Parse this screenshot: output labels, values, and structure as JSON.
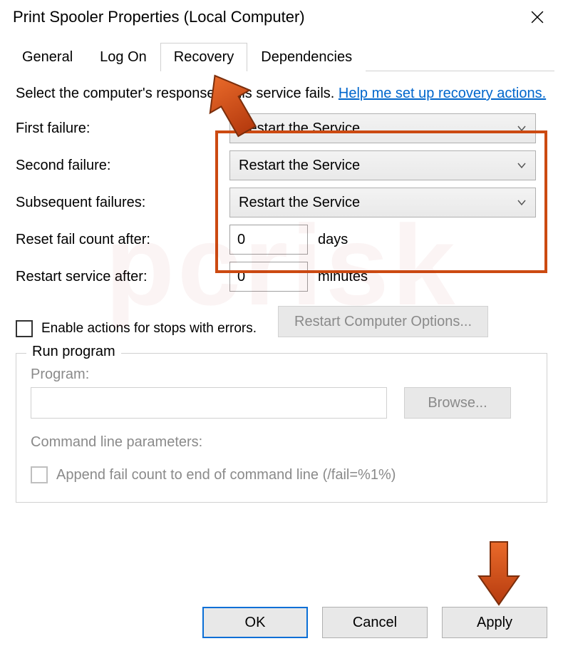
{
  "title": "Print Spooler Properties (Local Computer)",
  "tabs": {
    "general": "General",
    "logon": "Log On",
    "recovery": "Recovery",
    "dependencies": "Dependencies"
  },
  "intro": {
    "text_before": "Select the computer's response if this service fails. ",
    "link": "Help me set up recovery actions."
  },
  "failure": {
    "first_label": "First failure:",
    "first_value": "Restart the Service",
    "second_label": "Second failure:",
    "second_value": "Restart the Service",
    "subsequent_label": "Subsequent failures:",
    "subsequent_value": "Restart the Service"
  },
  "reset": {
    "label": "Reset fail count after:",
    "value": "0",
    "unit": "days"
  },
  "restart": {
    "label": "Restart service after:",
    "value": "0",
    "unit": "minutes"
  },
  "enable_actions_label": "Enable actions for stops with errors.",
  "restart_computer_options": "Restart Computer Options...",
  "run_program": {
    "title": "Run program",
    "program_label": "Program:",
    "browse": "Browse...",
    "cmd_label": "Command line parameters:",
    "append_label": "Append fail count to end of command line (/fail=%1%)"
  },
  "buttons": {
    "ok": "OK",
    "cancel": "Cancel",
    "apply": "Apply"
  }
}
